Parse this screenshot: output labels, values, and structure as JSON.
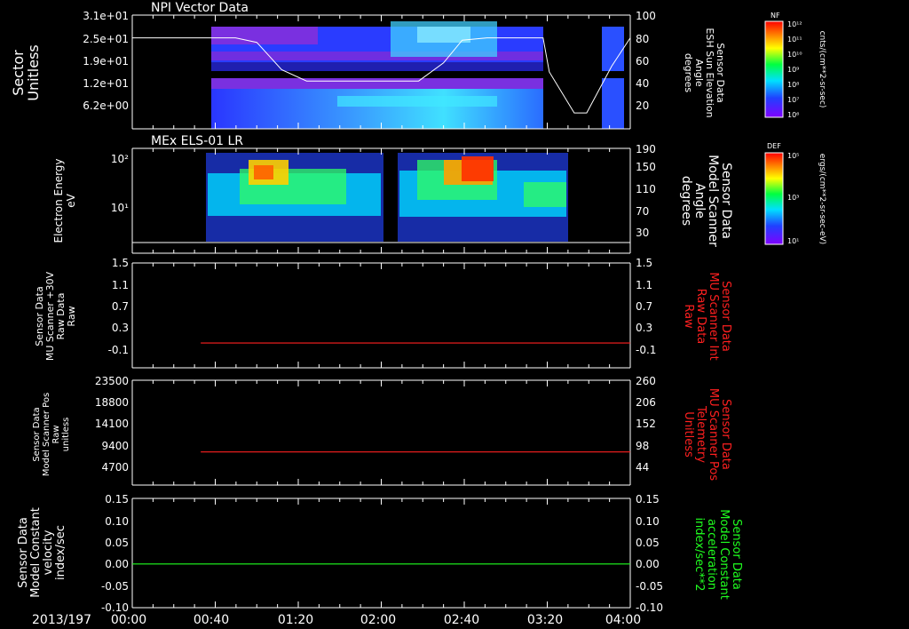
{
  "time_axis": {
    "date": "2013/197",
    "ticks": [
      "00:00",
      "00:40",
      "01:20",
      "02:00",
      "02:40",
      "03:20",
      "04:00"
    ]
  },
  "panels": [
    {
      "title": "NPI Vector Data",
      "left_label": [
        "Sector",
        "Unitless"
      ],
      "left_ticks": [
        "3.1e+01",
        "2.5e+01",
        "1.9e+01",
        "1.2e+01",
        "6.2e+00"
      ],
      "right_label": [
        "Sensor Data",
        "ESH Sun Elevation",
        "Angle",
        "degrees"
      ],
      "right_ticks": [
        "100",
        "80",
        "60",
        "40",
        "20"
      ],
      "colorbar": {
        "label": "NF",
        "unit": "cnts/(cm**2-sr-sec)",
        "ticks": [
          "10¹²",
          "10¹¹",
          "10¹⁰",
          "10⁹",
          "10⁸",
          "10⁷",
          "10⁶"
        ]
      }
    },
    {
      "title": "MEx ELS-01 LR",
      "left_label": [
        "Electron Energy",
        "eV"
      ],
      "left_ticks": [
        "10²",
        "10¹"
      ],
      "right_label": [
        "Sensor Data",
        "Model Scanner",
        "Angle",
        "degrees"
      ],
      "right_ticks": [
        "190",
        "150",
        "110",
        "70",
        "30"
      ],
      "colorbar": {
        "label": "DEF",
        "unit": "ergs/(cm**2-sr-sec-eV)",
        "ticks": [
          "10⁵",
          "10³",
          "10¹"
        ]
      }
    },
    {
      "left_label": [
        "Sensor Data",
        "MU Scanner +30V",
        "Raw Data",
        "Raw"
      ],
      "left_ticks": [
        "1.5",
        "1.1",
        "0.7",
        "0.3",
        "-0.1"
      ],
      "right_label": [
        "Sensor Data",
        "MU Scanner Int",
        "Raw Data",
        "Raw"
      ],
      "right_ticks": [
        "1.5",
        "1.1",
        "0.7",
        "0.3",
        "-0.1"
      ]
    },
    {
      "left_label": [
        "Sensor Data",
        "Model Scanner Pos",
        "Raw",
        "unitless"
      ],
      "left_ticks": [
        "23500",
        "18800",
        "14100",
        "9400",
        "4700"
      ],
      "right_label": [
        "Sensor Data",
        "MU Scanner Pos",
        "Telemetry",
        "Unitless"
      ],
      "right_ticks": [
        "260",
        "206",
        "152",
        "98",
        "44"
      ]
    },
    {
      "left_label": [
        "Sensor Data",
        "Model Constant",
        "velocity",
        "index/sec"
      ],
      "left_ticks": [
        "0.15",
        "0.10",
        "0.05",
        "0.00",
        "-0.05",
        "-0.10"
      ],
      "right_label": [
        "Sensor Data",
        "Model Constant",
        "acceleration",
        "index/sec**2"
      ],
      "right_ticks": [
        "0.15",
        "0.10",
        "0.05",
        "0.00",
        "-0.05",
        "-0.10"
      ]
    }
  ],
  "chart_data": [
    {
      "type": "heatmap",
      "title": "NPI Vector Data",
      "x_range_hours": [
        0,
        4
      ],
      "ylabel": "Sector Unitless",
      "ylim": [
        0,
        31
      ],
      "data_coverage_hours": [
        [
          0.83,
          3.33
        ],
        [
          3.62,
          4.0
        ]
      ],
      "overlay_series": {
        "label": "Sensor Data ESH Sun Elevation Angle",
        "unit": "degrees",
        "ylim": [
          0,
          100
        ],
        "x": [
          0,
          0.5,
          0.83,
          1.0,
          1.2,
          1.4,
          2.3,
          2.5,
          2.65,
          2.85,
          3.3,
          3.35,
          3.55,
          3.65,
          3.85,
          4.0
        ],
        "y": [
          80,
          80,
          80,
          76,
          52,
          42,
          42,
          58,
          78,
          80,
          80,
          50,
          14,
          14,
          55,
          80
        ]
      }
    },
    {
      "type": "heatmap",
      "title": "MEx ELS-01 LR",
      "x_range_hours": [
        0,
        4
      ],
      "ylabel": "Electron Energy eV",
      "ylog": true,
      "ylim": [
        1,
        250
      ],
      "data_coverage_hours": [
        [
          0.77,
          1.95
        ],
        [
          2.07,
          3.2
        ]
      ],
      "overlay_series": {
        "label": "Sensor Data Model Scanner Angle",
        "unit": "degrees",
        "ylim": [
          0,
          190
        ],
        "x": [
          0,
          4
        ],
        "y": [
          7,
          7
        ]
      }
    },
    {
      "type": "line",
      "series": [
        {
          "name": "Sensor Data MU Scanner Int Raw Data Raw",
          "x": [
            0.55,
            4.0
          ],
          "y": [
            0.05,
            0.05
          ],
          "color": "#ff2020"
        }
      ],
      "ylim": [
        -0.4,
        1.5
      ]
    },
    {
      "type": "line",
      "series": [
        {
          "name": "Sensor Data MU Scanner Pos Telemetry Unitless",
          "x": [
            0.55,
            4.0
          ],
          "y": [
            89,
            89
          ],
          "color": "#ff2020"
        }
      ],
      "ylim": [
        10,
        260
      ]
    },
    {
      "type": "line",
      "series": [
        {
          "name": "Sensor Data Model Constant acceleration index/sec**2",
          "x": [
            0,
            4
          ],
          "y": [
            0,
            0
          ],
          "color": "#20ff20"
        }
      ],
      "ylim": [
        -0.1,
        0.15
      ]
    }
  ],
  "colors": {
    "background": "#000000",
    "axis": "#ffffff",
    "red_label": "#ff2020",
    "green_label": "#20ff20"
  }
}
